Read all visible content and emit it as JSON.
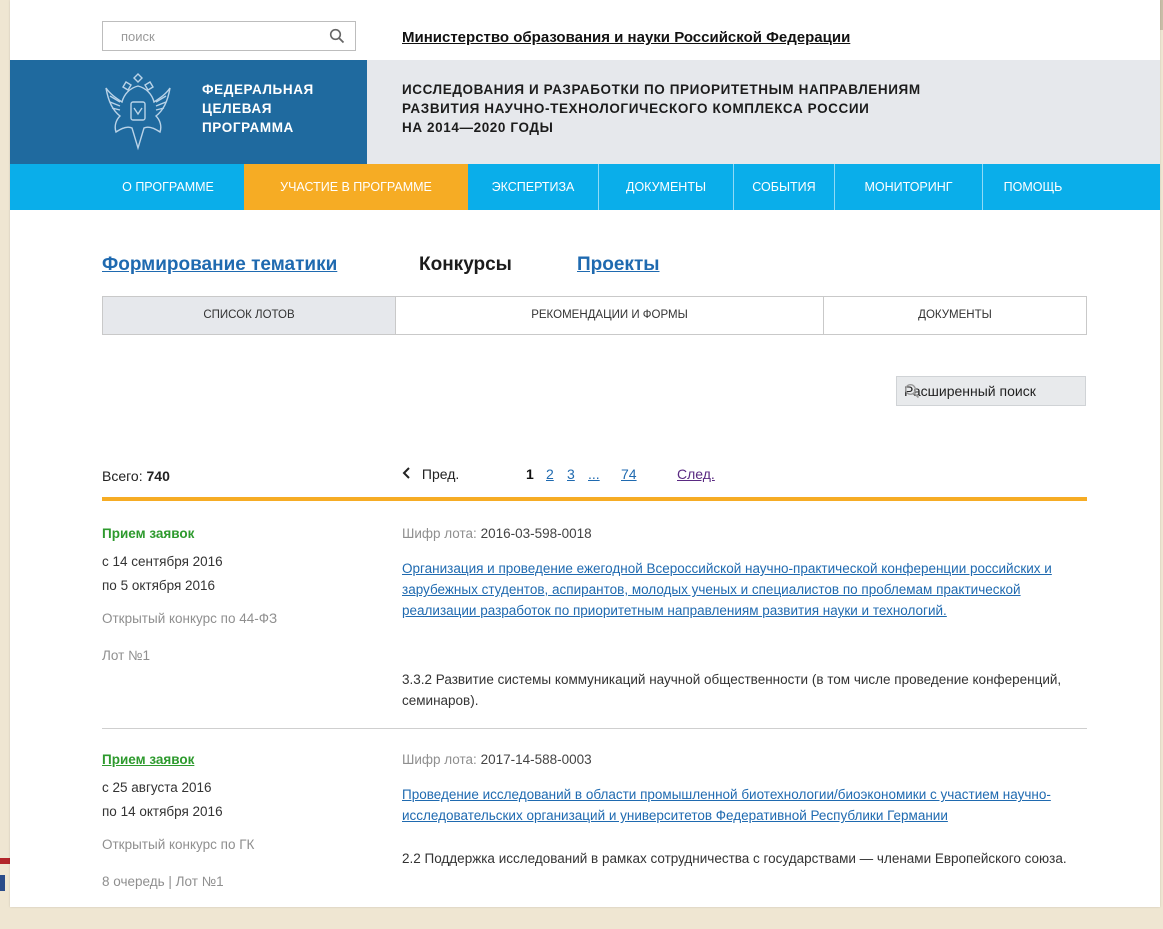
{
  "top": {
    "search_placeholder": "поиск",
    "ministry_link": "Министерство образования и науки Российской Федерации"
  },
  "header": {
    "logo_lines": [
      "ФЕДЕРАЛЬНАЯ",
      "ЦЕЛЕВАЯ",
      "ПРОГРАММА"
    ],
    "title_lines": [
      "ИССЛЕДОВАНИЯ И РАЗРАБОТКИ ПО ПРИОРИТЕТНЫМ НАПРАВЛЕНИЯМ",
      "РАЗВИТИЯ НАУЧНО-ТЕХНОЛОГИЧЕСКОГО КОМПЛЕКСА РОССИИ",
      "НА 2014—2020 ГОДЫ"
    ]
  },
  "nav": {
    "items": [
      {
        "label": "О ПРОГРАММЕ"
      },
      {
        "label": "УЧАСТИЕ В ПРОГРАММЕ",
        "active": true
      },
      {
        "label": "ЭКСПЕРТИЗА"
      },
      {
        "label": "ДОКУМЕНТЫ"
      },
      {
        "label": "СОБЫТИЯ"
      },
      {
        "label": "МОНИТОРИНГ"
      },
      {
        "label": "ПОМОЩЬ"
      }
    ]
  },
  "section_tabs": [
    {
      "label": "Формирование тематики"
    },
    {
      "label": "Конкурсы",
      "current": true
    },
    {
      "label": "Проекты"
    }
  ],
  "subtabs": [
    {
      "label": "СПИСОК ЛОТОВ",
      "active": true
    },
    {
      "label": "РЕКОМЕНДАЦИИ И ФОРМЫ"
    },
    {
      "label": "ДОКУМЕНТЫ"
    }
  ],
  "advanced_search": {
    "label": "Расширенный поиск"
  },
  "pagination": {
    "total_label": "Всего:",
    "total_value": "740",
    "prev_label": "Пред.",
    "current": "1",
    "pages": [
      "2",
      "3",
      "...",
      "74"
    ],
    "next_label": "След."
  },
  "lots": [
    {
      "status": "Прием заявок",
      "date_from": "с 14 сентября 2016",
      "date_to": "по 5 октября 2016",
      "contest_type": "Открытый конкурс по 44-ФЗ",
      "lot_number": "Лот №1",
      "code_label": "Шифр лота:",
      "code": "2016-03-598-0018",
      "title": "Организация и проведение ежегодной Всероссийской научно-практической конференции российских и зарубежных студентов, аспирантов, молодых ученых и специалистов по проблемам практической реализации разработок по приоритетным направлениям развития науки и технологий.",
      "direction": "3.3.2 Развитие системы коммуникаций научной общественности (в том числе проведение конференций, семинаров)."
    },
    {
      "status": "Прием заявок",
      "date_from": "с 25 августа 2016",
      "date_to": "по 14 октября 2016",
      "contest_type": "Открытый конкурс по ГК",
      "lot_number": "8 очередь | Лот №1",
      "code_label": "Шифр лота:",
      "code": "2017-14-588-0003",
      "title": "Проведение исследований в области промышленной биотехнологии/биоэкономики с участием научно-исследовательских организаций и университетов Федеративной Республики Германии",
      "direction": "2.2 Поддержка исследований в рамках сотрудничества с государствами — членами Европейского союза."
    }
  ],
  "colors": {
    "nav_bg": "#0aaeea",
    "nav_active": "#f6ac24",
    "logo_bg": "#1f6a9f",
    "link": "#1f6ab0",
    "status_green": "#2d9a2d",
    "accent_line": "#f6ac24"
  },
  "icons": {
    "search": "search-icon",
    "emblem": "coat-of-arms-icon",
    "prev": "chevron-left-icon"
  }
}
